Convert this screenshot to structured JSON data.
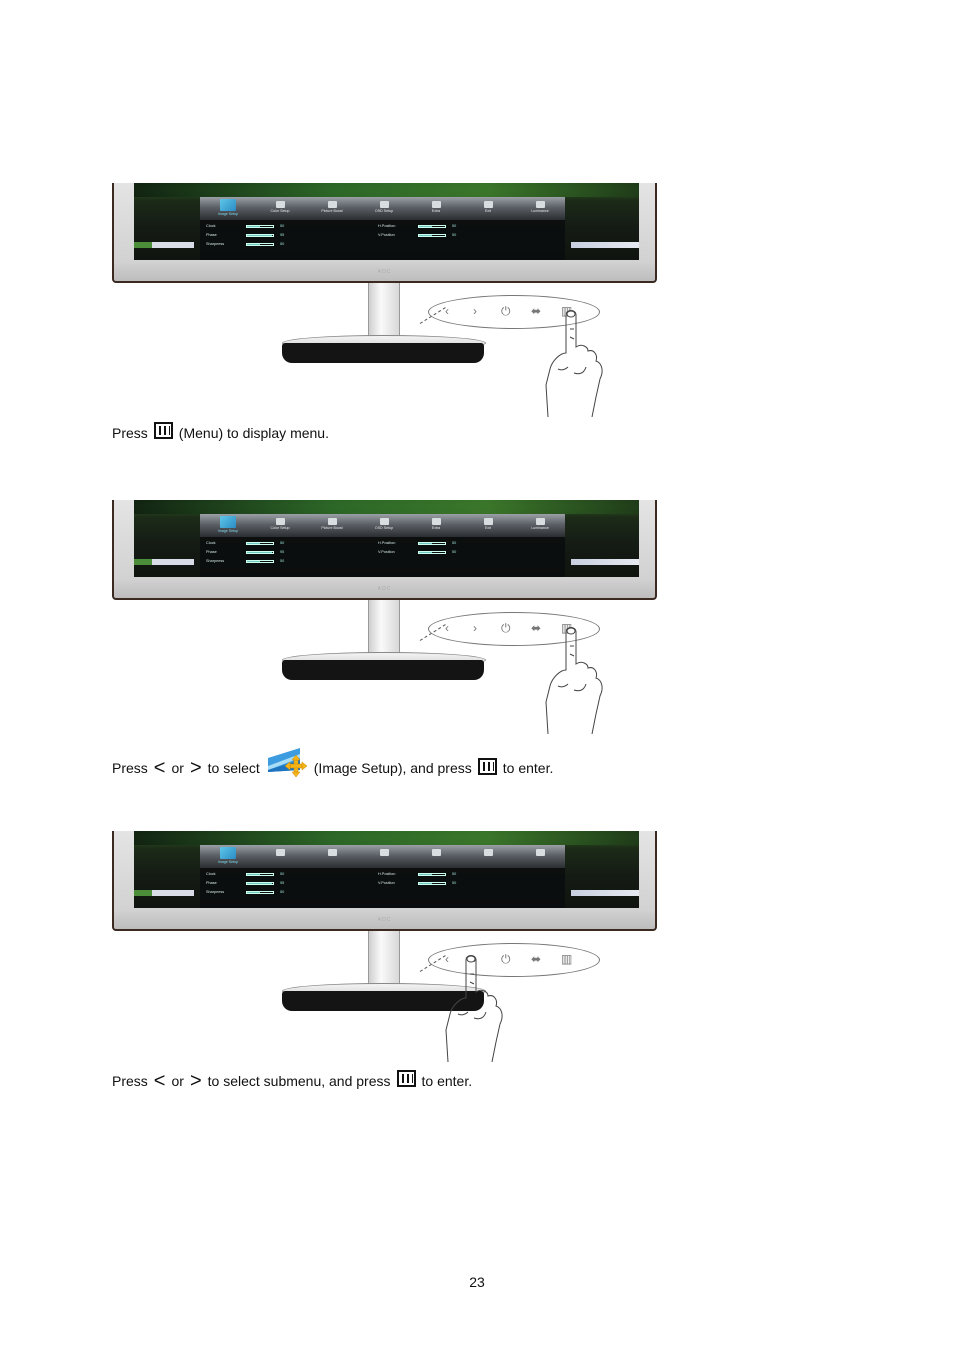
{
  "figures": [
    {
      "osd": {
        "active_tab": 0,
        "tabs": [
          "Image Setup",
          "Color Setup",
          "Picture Boost",
          "OSD Setup",
          "Extra",
          "Exit",
          "Luminance"
        ],
        "rows_left": [
          {
            "label": "Clock",
            "value": "50",
            "fill": 0.5
          },
          {
            "label": "Phase",
            "value": "95",
            "fill": 0.95
          },
          {
            "label": "Sharpness",
            "value": "50",
            "fill": 0.5
          }
        ],
        "rows_right": [
          {
            "label": "H.Position",
            "value": "50",
            "fill": 0.5
          },
          {
            "label": "V.Position",
            "value": "50",
            "fill": 0.5
          }
        ],
        "show_labels": true
      },
      "brand": "AOC",
      "pressed_button": "menu"
    },
    {
      "osd": {
        "active_tab": 0,
        "tabs": [
          "Image Setup",
          "Color Setup",
          "Picture Boost",
          "OSD Setup",
          "Extra",
          "Exit",
          "Luminance"
        ],
        "rows_left": [
          {
            "label": "Clock",
            "value": "50",
            "fill": 0.5
          },
          {
            "label": "Phase",
            "value": "95",
            "fill": 0.95
          },
          {
            "label": "Sharpness",
            "value": "50",
            "fill": 0.5
          }
        ],
        "rows_right": [
          {
            "label": "H.Position",
            "value": "50",
            "fill": 0.5
          },
          {
            "label": "V.Position",
            "value": "50",
            "fill": 0.5
          }
        ],
        "show_labels": true
      },
      "brand": "AOC",
      "pressed_button": "menu"
    },
    {
      "osd": {
        "active_tab": 0,
        "tabs": [
          "Image Setup",
          "",
          "",
          "",
          "",
          "",
          ""
        ],
        "rows_left": [
          {
            "label": "Clock",
            "value": "50",
            "fill": 0.5
          },
          {
            "label": "Phase",
            "value": "95",
            "fill": 0.95
          },
          {
            "label": "Sharpness",
            "value": "50",
            "fill": 0.5
          }
        ],
        "rows_right": [
          {
            "label": "H.Position",
            "value": "50",
            "fill": 0.5
          },
          {
            "label": "V.Position",
            "value": "50",
            "fill": 0.5
          }
        ],
        "show_labels": false
      },
      "brand": "AOC",
      "pressed_button": "left-right"
    }
  ],
  "buttons": {
    "left": "<",
    "right": ">",
    "power": "power-icon",
    "source": "source-auto-icon",
    "menu": "menu-icon"
  },
  "captions": {
    "cap1": {
      "press": "Press",
      "rest": "(Menu) to display menu."
    },
    "cap2": {
      "press": "Press",
      "or": "or",
      "to_select": "to select",
      "item": "(Image Setup), and press",
      "end": "to enter."
    },
    "cap3": {
      "press": "Press",
      "or": "or",
      "to_select": "to select submenu, and press",
      "end": "to enter."
    }
  },
  "glyphs": {
    "left_arrow": "<",
    "right_arrow": ">"
  },
  "page_number": "23"
}
